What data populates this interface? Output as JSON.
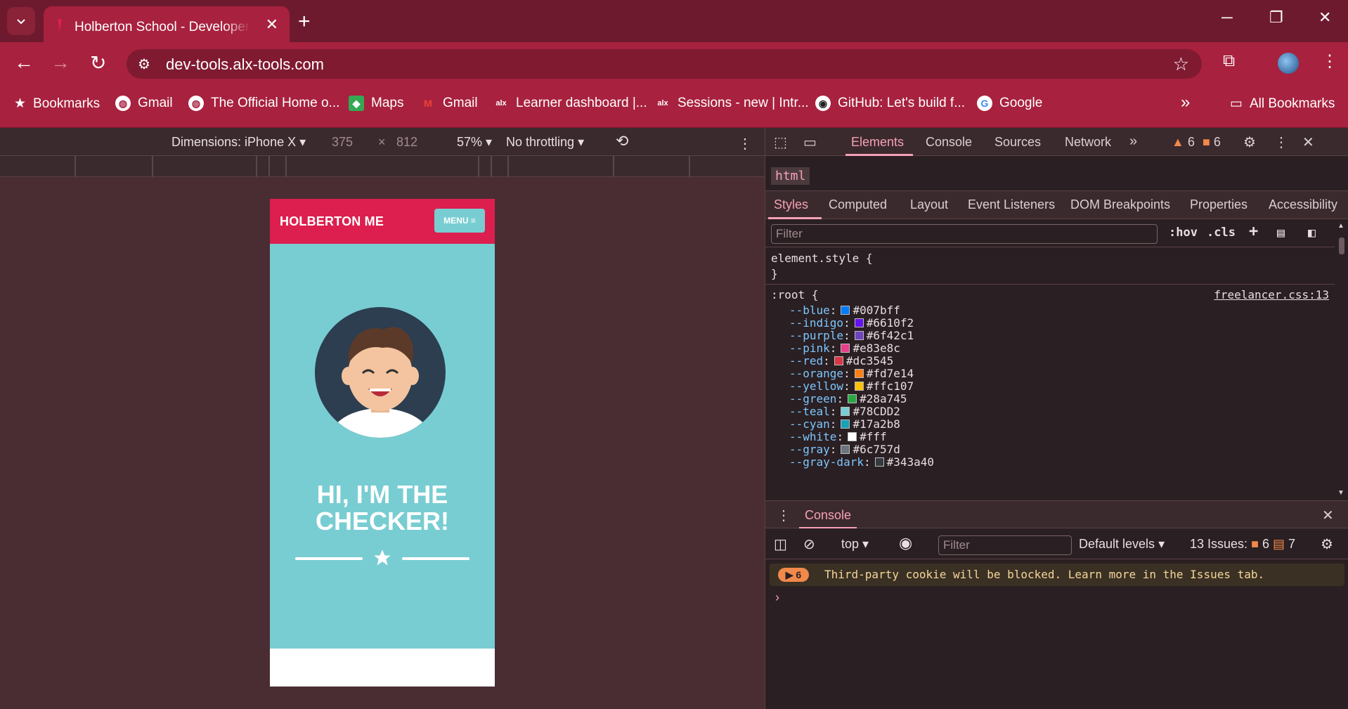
{
  "browser": {
    "tab_title": "Holberton School - Developer t",
    "new_tab": "+",
    "win_min": "─",
    "win_restore": "❐",
    "win_close": "✕",
    "tab_close": "✕",
    "url": "dev-tools.alx-tools.com",
    "bookmarks": [
      {
        "label": "Bookmarks",
        "icon": "star-icon"
      },
      {
        "label": "Gmail",
        "icon": "globe-icon"
      },
      {
        "label": "The Official Home o...",
        "icon": "globe-icon"
      },
      {
        "label": "Maps",
        "icon": "maps-icon"
      },
      {
        "label": "Gmail",
        "icon": "gmail-icon"
      },
      {
        "label": "Learner dashboard |...",
        "icon": "alx-icon"
      },
      {
        "label": "Sessions - new | Intr...",
        "icon": "alx-icon"
      },
      {
        "label": "GitHub: Let's build f...",
        "icon": "github-icon"
      },
      {
        "label": "Google",
        "icon": "google-icon"
      }
    ],
    "more_bookmarks": "»",
    "all_bookmarks": "All Bookmarks"
  },
  "device_toolbar": {
    "dimensions": "Dimensions: iPhone X",
    "width": "375",
    "times": "×",
    "height": "812",
    "zoom": "57%",
    "throttling": "No throttling"
  },
  "page": {
    "brand": "HOLBERTON ME",
    "menu": "MENU ≡",
    "hero_title_1": "HI, I'M THE",
    "hero_title_2": "CHECKER!",
    "colors": {
      "nav": "#dc1f4e",
      "hero": "#78cdd2"
    }
  },
  "devtools": {
    "tabs": [
      "Elements",
      "Console",
      "Sources",
      "Network"
    ],
    "more_tabs": "»",
    "warnings": "6",
    "errors": "6",
    "crumb": "html",
    "subtabs": [
      "Styles",
      "Computed",
      "Layout",
      "Event Listeners",
      "DOM Breakpoints",
      "Properties",
      "Accessibility"
    ],
    "filter_placeholder": "Filter",
    "hov": ":hov",
    "cls": ".cls",
    "element_style_open": "element.style {",
    "element_style_close": "}",
    "root_open": ":root {",
    "source_link": "freelancer.css:13",
    "variables": [
      {
        "name": "--blue",
        "value": "#007bff"
      },
      {
        "name": "--indigo",
        "value": "#6610f2"
      },
      {
        "name": "--purple",
        "value": "#6f42c1"
      },
      {
        "name": "--pink",
        "value": "#e83e8c"
      },
      {
        "name": "--red",
        "value": "#dc3545"
      },
      {
        "name": "--orange",
        "value": "#fd7e14"
      },
      {
        "name": "--yellow",
        "value": "#ffc107"
      },
      {
        "name": "--green",
        "value": "#28a745"
      },
      {
        "name": "--teal",
        "value": "#78CDD2"
      },
      {
        "name": "--cyan",
        "value": "#17a2b8"
      },
      {
        "name": "--white",
        "value": "#fff"
      },
      {
        "name": "--gray",
        "value": "#6c757d"
      },
      {
        "name": "--gray-dark",
        "value": "#343a40"
      }
    ],
    "drawer_title": "Console",
    "context": "top",
    "console_filter_placeholder": "Filter",
    "levels": "Default levels",
    "issues_label": "13 Issues:",
    "issues_warn": "6",
    "issues_info": "7",
    "warn_count": "6",
    "warn_message": "Third-party cookie will be blocked. Learn more in the Issues tab.",
    "prompt": "›"
  }
}
